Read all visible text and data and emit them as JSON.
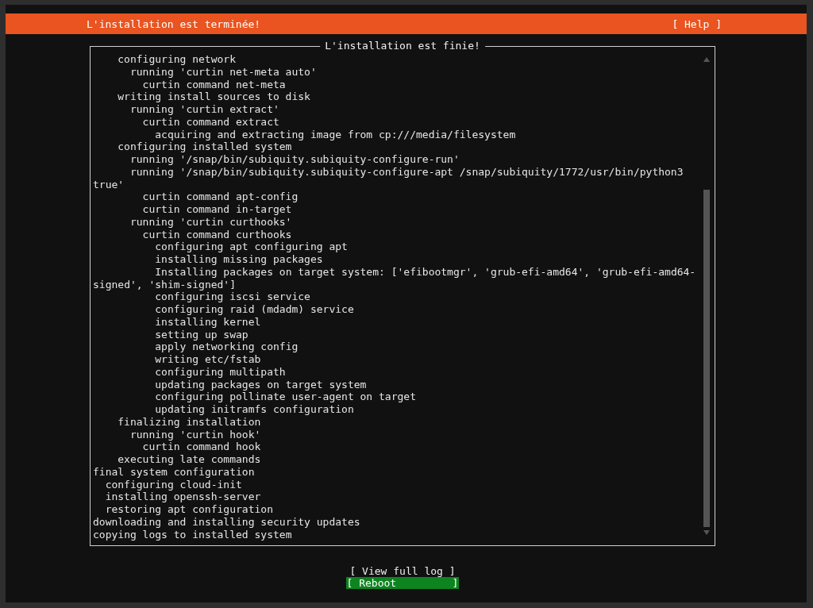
{
  "header": {
    "title": "L'installation est terminée!",
    "help": "[ Help ]"
  },
  "log": {
    "title": "L'installation est finie!",
    "items": [
      {
        "children": [
          {
            "children": [
              {
                "text": "configuring network",
                "children": [
                  {
                    "text": "running 'curtin net-meta auto'",
                    "children": [
                      {
                        "text": "curtin command net-meta"
                      }
                    ]
                  }
                ]
              },
              {
                "text": "writing install sources to disk",
                "children": [
                  {
                    "text": "running 'curtin extract'",
                    "children": [
                      {
                        "text": "curtin command extract",
                        "children": [
                          {
                            "text": "acquiring and extracting image from cp:///media/filesystem"
                          }
                        ]
                      }
                    ]
                  }
                ]
              },
              {
                "text": "configuring installed system",
                "children": [
                  {
                    "text": "running '/snap/bin/subiquity.subiquity-configure-run'"
                  },
                  {
                    "text": "running '/snap/bin/subiquity.subiquity-configure-apt /snap/subiquity/1772/usr/bin/python3 true'",
                    "children": [
                      {
                        "text": "curtin command apt-config"
                      },
                      {
                        "text": "curtin command in-target"
                      }
                    ]
                  },
                  {
                    "text": "running 'curtin curthooks'",
                    "children": [
                      {
                        "text": "curtin command curthooks",
                        "children": [
                          {
                            "text": "configuring apt configuring apt"
                          },
                          {
                            "text": "installing missing packages"
                          },
                          {
                            "text": "Installing packages on target system: ['efibootmgr', 'grub-efi-amd64', 'grub-efi-amd64-signed', 'shim-signed']"
                          },
                          {
                            "text": "configuring iscsi service"
                          },
                          {
                            "text": "configuring raid (mdadm) service"
                          },
                          {
                            "text": "installing kernel"
                          },
                          {
                            "text": "setting up swap"
                          },
                          {
                            "text": "apply networking config"
                          },
                          {
                            "text": "writing etc/fstab"
                          },
                          {
                            "text": "configuring multipath"
                          },
                          {
                            "text": "updating packages on target system"
                          },
                          {
                            "text": "configuring pollinate user-agent on target"
                          },
                          {
                            "text": "updating initramfs configuration"
                          }
                        ]
                      }
                    ]
                  }
                ]
              },
              {
                "text": "finalizing installation",
                "children": [
                  {
                    "text": "running 'curtin hook'",
                    "children": [
                      {
                        "text": "curtin command hook"
                      }
                    ]
                  }
                ]
              },
              {
                "text": "executing late commands"
              }
            ]
          }
        ]
      },
      {
        "text": "final system configuration",
        "children": [
          {
            "text": "configuring cloud-init"
          },
          {
            "text": "installing openssh-server"
          },
          {
            "text": "restoring apt configuration"
          }
        ]
      },
      {
        "text": "downloading and installing security updates"
      },
      {
        "text": "copying logs to installed system"
      }
    ]
  },
  "buttons": [
    {
      "label": "[ View full log ]",
      "selected": false
    },
    {
      "label": "[ Reboot         ]",
      "selected": true
    }
  ]
}
